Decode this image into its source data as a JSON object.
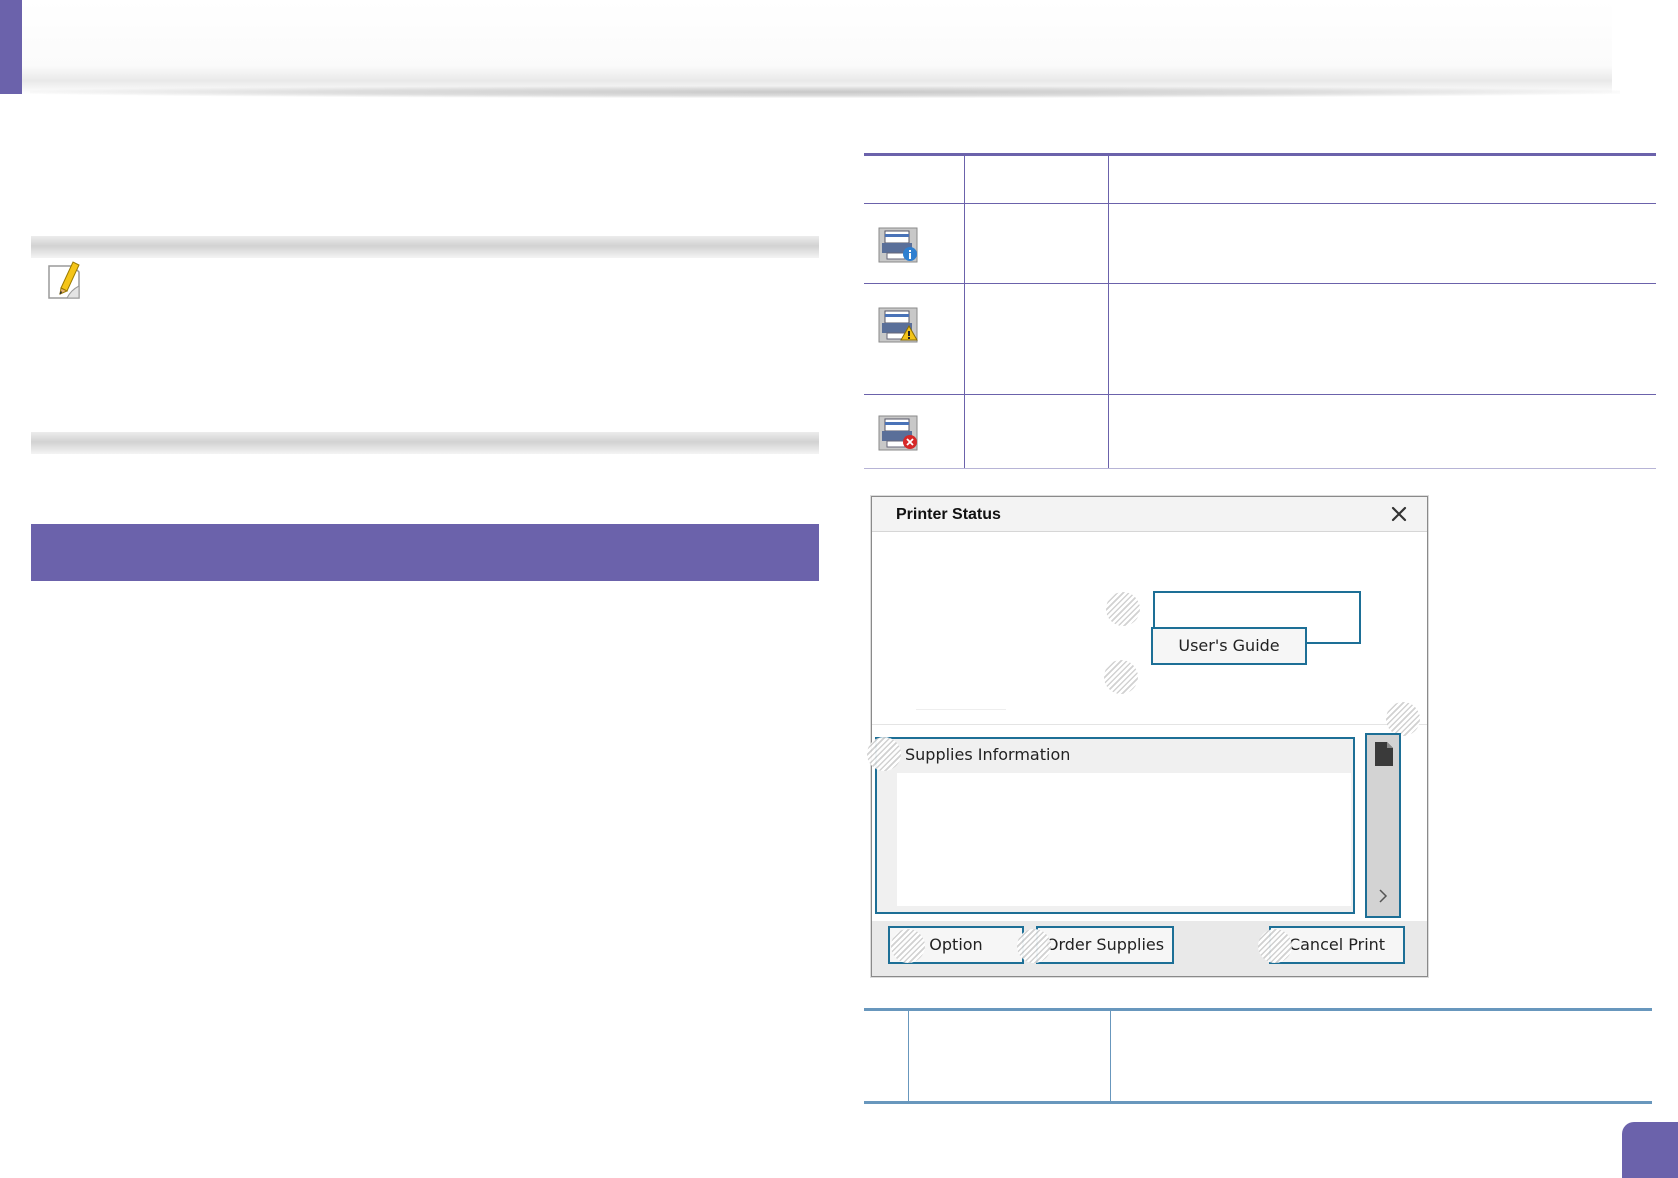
{
  "page": {
    "section_heading": "",
    "page_number": "",
    "accent_color": "#6b62ab"
  },
  "note": {
    "icon": "note-pencil-icon",
    "text": ""
  },
  "status_table": {
    "headers": [
      "",
      "",
      ""
    ],
    "rows": [
      {
        "icon": "printer-info-icon",
        "label": "",
        "description": ""
      },
      {
        "icon": "printer-warning-icon",
        "label": "",
        "description": ""
      },
      {
        "icon": "printer-error-icon",
        "label": "",
        "description": ""
      }
    ]
  },
  "dialog": {
    "title": "Printer Status",
    "close_icon": "close-icon",
    "user_guide_button": "User's Guide",
    "supplies_label": "Supplies Information",
    "side_strip_icon": "document-icon",
    "side_strip_arrow": "chevron-right-icon",
    "option_button": "Option",
    "order_supplies_button": "Order Supplies",
    "cancel_print_button": "Cancel Print",
    "border_color": "#1d6f96"
  },
  "bottom_table": {
    "cells": [
      "",
      "",
      ""
    ]
  }
}
